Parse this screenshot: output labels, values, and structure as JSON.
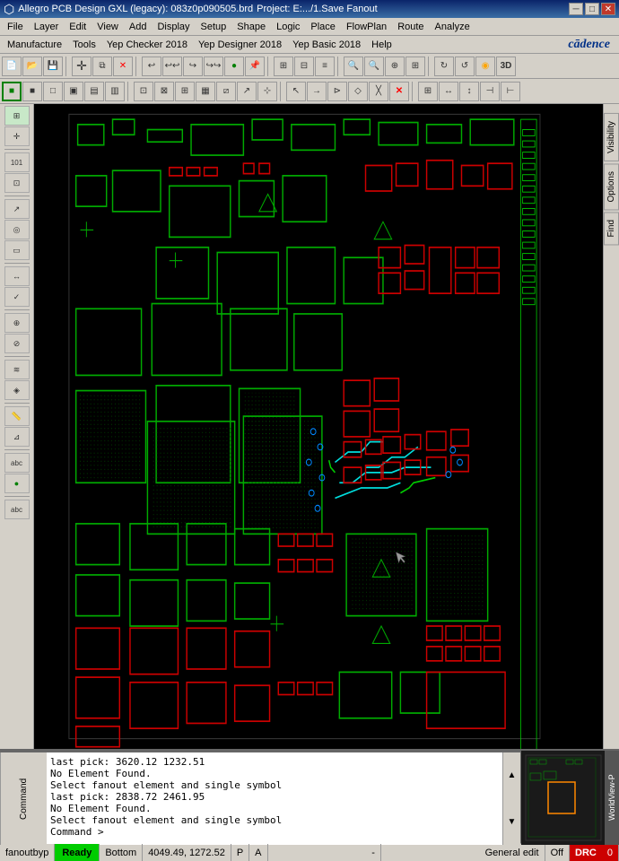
{
  "title": {
    "app_name": "Allegro PCB Design GXL (legacy): 083z0p090505.brd",
    "project": "Project: E:.../1.Save Fanout",
    "icon": "pcb-icon"
  },
  "title_controls": {
    "minimize": "─",
    "maximize": "□",
    "close": "✕"
  },
  "menu_bar1": {
    "items": [
      "File",
      "Layer",
      "Edit",
      "View",
      "Add",
      "Display",
      "Setup",
      "Shape",
      "Logic",
      "Place",
      "FlowPlan",
      "Route",
      "Analyze"
    ]
  },
  "menu_bar2": {
    "items": [
      "Manufacture",
      "Tools",
      "Yep Checker 2018",
      "Yep Designer 2018",
      "Yep Basic 2018",
      "Help"
    ],
    "logo": "cādence"
  },
  "right_panel": {
    "tabs": [
      "Visibility",
      "Options",
      "Find"
    ]
  },
  "command_window": {
    "label": "Command",
    "lines": [
      "last pick:  3620.12 1232.51",
      "No Element Found.",
      "Select fanout element and single symbol",
      "last pick:  2838.72 2461.95",
      "No Element Found.",
      "Select fanout element and single symbol",
      "Command >"
    ]
  },
  "worldview": {
    "label": "WorldView-P"
  },
  "status_bar": {
    "script": "fanoutbyp",
    "ready": "Ready",
    "layer": "Bottom",
    "coordinates": "4049.49, 1272.52",
    "p_indicator": "P",
    "a_indicator": "A",
    "dash": "-",
    "edit_mode": "General edit",
    "off_label": "Off",
    "drc_label": "DRC",
    "drc_count": "0"
  }
}
